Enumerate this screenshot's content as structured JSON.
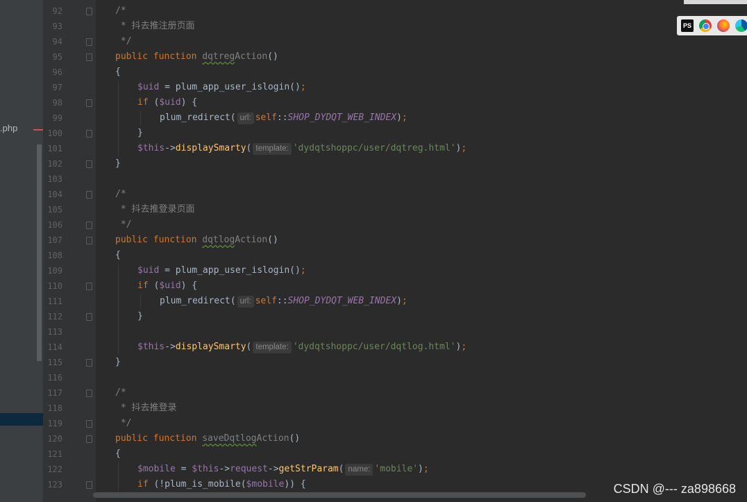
{
  "sidebar": {
    "file_suffix": ".php"
  },
  "browser_icons": [
    "phpstorm-icon",
    "chrome-icon",
    "firefox-icon",
    "edge-icon"
  ],
  "browser_label": "PS",
  "watermark": "CSDN @---   za898668",
  "lines": [
    {
      "n": "92",
      "fold": true,
      "indent": 0,
      "tokens": [
        {
          "t": "/*",
          "c": "comment"
        }
      ]
    },
    {
      "n": "93",
      "fold": false,
      "indent": 0,
      "tokens": [
        {
          "t": " * 抖去推注册页面",
          "c": "comment"
        }
      ]
    },
    {
      "n": "94",
      "fold": true,
      "indent": 0,
      "tokens": [
        {
          "t": " */",
          "c": "comment"
        }
      ]
    },
    {
      "n": "95",
      "fold": true,
      "indent": 0,
      "tokens": [
        {
          "t": "public function ",
          "c": "keyword"
        },
        {
          "t": "dqtreg",
          "c": "fn"
        },
        {
          "t": "Action",
          "c": "fname"
        },
        {
          "t": "()",
          "c": "plain"
        }
      ]
    },
    {
      "n": "96",
      "fold": false,
      "indent": 0,
      "tokens": [
        {
          "t": "{",
          "c": "plain"
        }
      ]
    },
    {
      "n": "97",
      "fold": false,
      "indent": 1,
      "tokens": [
        {
          "t": "$uid",
          "c": "var"
        },
        {
          "t": " = plum_app_user_islogin()",
          "c": "plain"
        },
        {
          "t": ";",
          "c": "keyword"
        }
      ]
    },
    {
      "n": "98",
      "fold": true,
      "indent": 1,
      "tokens": [
        {
          "t": "if ",
          "c": "keyword"
        },
        {
          "t": "(",
          "c": "plain"
        },
        {
          "t": "$uid",
          "c": "var"
        },
        {
          "t": ") {",
          "c": "plain"
        }
      ]
    },
    {
      "n": "99",
      "fold": false,
      "indent": 2,
      "tokens": [
        {
          "t": "plum_redirect(",
          "c": "plain"
        },
        {
          "t": "url:",
          "c": "hint"
        },
        {
          "t": "self",
          "c": "keyword"
        },
        {
          "t": "::",
          "c": "plain"
        },
        {
          "t": "SHOP_DYDQT_WEB_INDEX",
          "c": "const"
        },
        {
          "t": ")",
          "c": "plain"
        },
        {
          "t": ";",
          "c": "keyword"
        }
      ]
    },
    {
      "n": "100",
      "fold": true,
      "indent": 1,
      "tokens": [
        {
          "t": "}",
          "c": "plain"
        }
      ]
    },
    {
      "n": "101",
      "fold": false,
      "indent": 1,
      "tokens": [
        {
          "t": "$this",
          "c": "var"
        },
        {
          "t": "->",
          "c": "plain"
        },
        {
          "t": "displaySmarty",
          "c": "call"
        },
        {
          "t": "(",
          "c": "plain"
        },
        {
          "t": "template:",
          "c": "hint"
        },
        {
          "t": "'dydqtshoppc/user/dqtreg.html'",
          "c": "string"
        },
        {
          "t": ")",
          "c": "plain"
        },
        {
          "t": ";",
          "c": "keyword"
        }
      ]
    },
    {
      "n": "102",
      "fold": true,
      "indent": 0,
      "tokens": [
        {
          "t": "}",
          "c": "plain"
        }
      ]
    },
    {
      "n": "103",
      "fold": false,
      "indent": 0,
      "tokens": []
    },
    {
      "n": "104",
      "fold": true,
      "indent": 0,
      "tokens": [
        {
          "t": "/*",
          "c": "comment"
        }
      ]
    },
    {
      "n": "105",
      "fold": false,
      "indent": 0,
      "tokens": [
        {
          "t": " * 抖去推登录页面",
          "c": "comment"
        }
      ]
    },
    {
      "n": "106",
      "fold": true,
      "indent": 0,
      "tokens": [
        {
          "t": " */",
          "c": "comment"
        }
      ]
    },
    {
      "n": "107",
      "fold": true,
      "indent": 0,
      "tokens": [
        {
          "t": "public function ",
          "c": "keyword"
        },
        {
          "t": "dqtlog",
          "c": "fn"
        },
        {
          "t": "Action",
          "c": "fname"
        },
        {
          "t": "()",
          "c": "plain"
        }
      ]
    },
    {
      "n": "108",
      "fold": false,
      "indent": 0,
      "tokens": [
        {
          "t": "{",
          "c": "plain"
        }
      ]
    },
    {
      "n": "109",
      "fold": false,
      "indent": 1,
      "tokens": [
        {
          "t": "$uid",
          "c": "var"
        },
        {
          "t": " = plum_app_user_islogin()",
          "c": "plain"
        },
        {
          "t": ";",
          "c": "keyword"
        }
      ]
    },
    {
      "n": "110",
      "fold": true,
      "indent": 1,
      "tokens": [
        {
          "t": "if ",
          "c": "keyword"
        },
        {
          "t": "(",
          "c": "plain"
        },
        {
          "t": "$uid",
          "c": "var"
        },
        {
          "t": ") {",
          "c": "plain"
        }
      ]
    },
    {
      "n": "111",
      "fold": false,
      "indent": 2,
      "tokens": [
        {
          "t": "plum_redirect(",
          "c": "plain"
        },
        {
          "t": "url:",
          "c": "hint"
        },
        {
          "t": "self",
          "c": "keyword"
        },
        {
          "t": "::",
          "c": "plain"
        },
        {
          "t": "SHOP_DYDQT_WEB_INDEX",
          "c": "const"
        },
        {
          "t": ")",
          "c": "plain"
        },
        {
          "t": ";",
          "c": "keyword"
        }
      ]
    },
    {
      "n": "112",
      "fold": true,
      "indent": 1,
      "tokens": [
        {
          "t": "}",
          "c": "plain"
        }
      ]
    },
    {
      "n": "113",
      "fold": false,
      "indent": 1,
      "tokens": []
    },
    {
      "n": "114",
      "fold": false,
      "indent": 1,
      "tokens": [
        {
          "t": "$this",
          "c": "var"
        },
        {
          "t": "->",
          "c": "plain"
        },
        {
          "t": "displaySmarty",
          "c": "call"
        },
        {
          "t": "(",
          "c": "plain"
        },
        {
          "t": "template:",
          "c": "hint"
        },
        {
          "t": "'dydqtshoppc/user/dqtlog.html'",
          "c": "string"
        },
        {
          "t": ")",
          "c": "plain"
        },
        {
          "t": ";",
          "c": "keyword"
        }
      ]
    },
    {
      "n": "115",
      "fold": true,
      "indent": 0,
      "tokens": [
        {
          "t": "}",
          "c": "plain"
        }
      ]
    },
    {
      "n": "116",
      "fold": false,
      "indent": 0,
      "tokens": []
    },
    {
      "n": "117",
      "fold": true,
      "indent": 0,
      "tokens": [
        {
          "t": "/*",
          "c": "comment"
        }
      ]
    },
    {
      "n": "118",
      "fold": false,
      "indent": 0,
      "tokens": [
        {
          "t": " * 抖去推登录",
          "c": "comment"
        }
      ]
    },
    {
      "n": "119",
      "fold": true,
      "indent": 0,
      "tokens": [
        {
          "t": " */",
          "c": "comment"
        }
      ]
    },
    {
      "n": "120",
      "fold": true,
      "indent": 0,
      "tokens": [
        {
          "t": "public function ",
          "c": "keyword"
        },
        {
          "t": "saveDqtlog",
          "c": "fn"
        },
        {
          "t": "Action",
          "c": "fname"
        },
        {
          "t": "()",
          "c": "plain"
        }
      ]
    },
    {
      "n": "121",
      "fold": false,
      "indent": 0,
      "tokens": [
        {
          "t": "{",
          "c": "plain"
        }
      ]
    },
    {
      "n": "122",
      "fold": false,
      "indent": 1,
      "tokens": [
        {
          "t": "$mobile",
          "c": "var"
        },
        {
          "t": " = ",
          "c": "plain"
        },
        {
          "t": "$this",
          "c": "var"
        },
        {
          "t": "->",
          "c": "plain"
        },
        {
          "t": "request",
          "c": "var"
        },
        {
          "t": "->",
          "c": "plain"
        },
        {
          "t": "getStrParam",
          "c": "call"
        },
        {
          "t": "(",
          "c": "plain"
        },
        {
          "t": "name:",
          "c": "hint"
        },
        {
          "t": "'mobile'",
          "c": "string"
        },
        {
          "t": ")",
          "c": "plain"
        },
        {
          "t": ";",
          "c": "keyword"
        }
      ]
    },
    {
      "n": "123",
      "fold": true,
      "indent": 1,
      "tokens": [
        {
          "t": "if ",
          "c": "keyword"
        },
        {
          "t": "(!plum_is_mobile(",
          "c": "plain"
        },
        {
          "t": "$mobile",
          "c": "var"
        },
        {
          "t": ")) {",
          "c": "plain"
        }
      ]
    }
  ]
}
